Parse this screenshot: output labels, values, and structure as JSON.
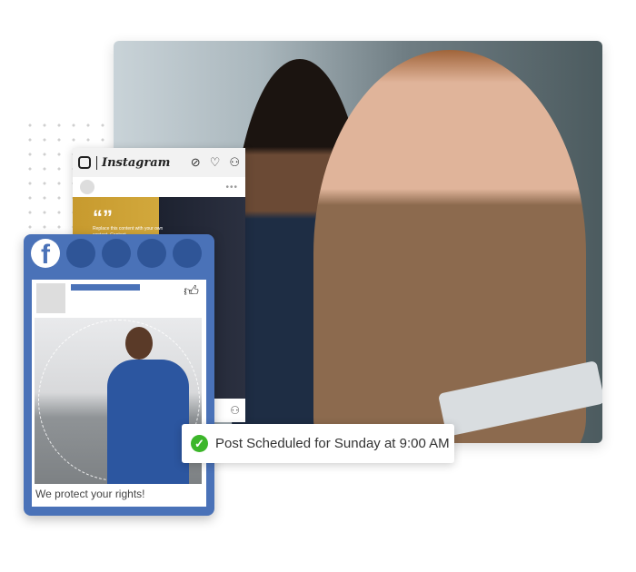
{
  "instagram": {
    "brand": "Instagram",
    "post_text_quote": "“”",
    "post_text": "Replace this content with your own content. Content",
    "icons": [
      "compass-icon",
      "heart-icon",
      "user-icon",
      "more-icon"
    ]
  },
  "facebook": {
    "brand": "f",
    "caption": "We protect your rights!",
    "icons": [
      "facebook-logo-icon",
      "thumbs-up-icon"
    ],
    "brand_color": "#4a72b8"
  },
  "toast": {
    "message": "Post Scheduled for Sunday at 9:00 AM",
    "status_color": "#3cb62a",
    "icon": "check-circle-icon"
  }
}
